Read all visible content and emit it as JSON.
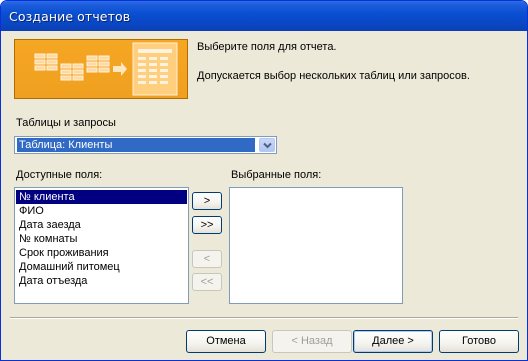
{
  "window": {
    "title": "Создание отчетов"
  },
  "header": {
    "line1": "Выберите поля для отчета.",
    "line2": "Допускается выбор нескольких таблиц или запросов."
  },
  "tables": {
    "label": "Таблицы и запросы",
    "selected": "Таблица: Клиенты"
  },
  "available": {
    "label": "Доступные поля:",
    "items": [
      "№ клиента",
      "ФИО",
      "Дата заезда",
      "№ комнаты",
      "Срок проживания",
      "Домашний питомец",
      "Дата отъезда"
    ],
    "selected_index": 0
  },
  "selected_fields": {
    "label": "Выбранные поля:",
    "items": []
  },
  "move_buttons": {
    "add_one": ">",
    "add_all": ">>",
    "remove_one": "<",
    "remove_all": "<<"
  },
  "footer": {
    "cancel": "Отмена",
    "back": "< Назад",
    "next": "Далее >",
    "finish": "Готово"
  },
  "colors": {
    "titlebar": "#0a4fd3",
    "dialog_bg": "#ece9d8",
    "selection": "#000080",
    "combo_selection": "#316ac5",
    "header_image": "#f0a020"
  }
}
